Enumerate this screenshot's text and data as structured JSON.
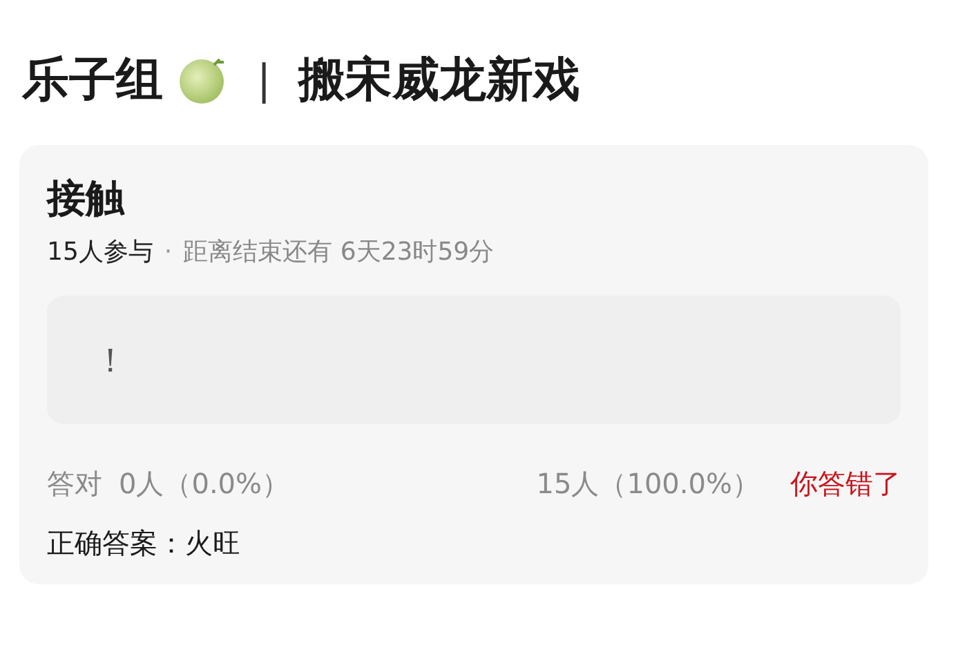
{
  "header": {
    "group": "乐子组",
    "separator": "|",
    "title": "搬宋威龙新戏"
  },
  "quiz": {
    "title": "接触",
    "participants": "15人参与",
    "dot": "·",
    "countdown": "距离结束还有 6天23时59分",
    "answer": "！",
    "stats": {
      "correct_label": "答对",
      "correct_count": "0人（0.0%）",
      "wrong_count": "15人（100.0%）",
      "result": "你答错了"
    },
    "correct_answer": "正确答案：火旺"
  }
}
